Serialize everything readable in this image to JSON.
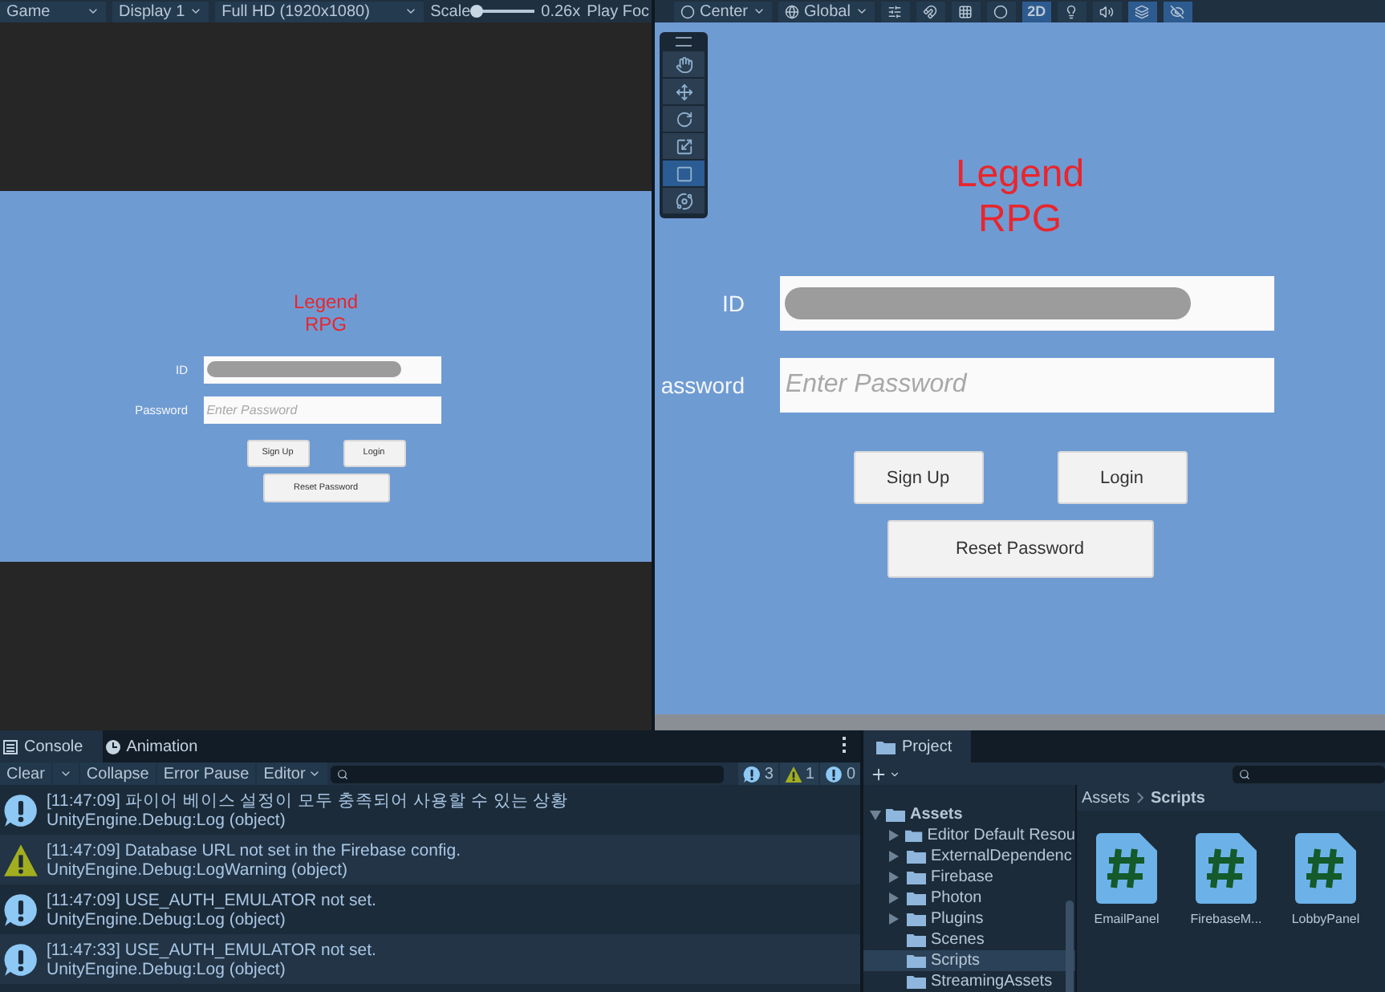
{
  "game_view": {
    "view_menu": "Game",
    "display": "Display 1",
    "resolution": "Full HD (1920x1080)",
    "scale_label": "Scale",
    "scale": {
      "level": 0.0
    },
    "scale_value": "0.26x",
    "play_focused": "Play Foc",
    "screen": {
      "title_lines": [
        "Legend",
        "RPG"
      ],
      "id_label": "ID",
      "id_redacted": true,
      "password_label": "Password",
      "password_placeholder": "Enter Password",
      "buttons": [
        "Sign Up",
        "Login"
      ],
      "reset_button": "Reset Password"
    }
  },
  "scene_view": {
    "pivot": "Center",
    "space": "Global",
    "mode_2d": {
      "label": "2D",
      "on": true
    },
    "tools": [
      {
        "kind": "hand",
        "selected": false
      },
      {
        "kind": "move",
        "selected": false
      },
      {
        "kind": "rotate",
        "selected": false
      },
      {
        "kind": "scale",
        "selected": false
      },
      {
        "kind": "rect",
        "selected": true
      },
      {
        "kind": "transform",
        "selected": false
      }
    ],
    "screen": {
      "title_lines": [
        "Legend",
        "RPG"
      ],
      "id_label": "ID",
      "id_redacted": true,
      "password_label": "assword",
      "password_placeholder": "Enter Password",
      "buttons": [
        "Sign Up",
        "Login"
      ],
      "reset_button": "Reset Password"
    }
  },
  "console": {
    "tabs": [
      {
        "label": "Console",
        "kind": "console",
        "selected": true
      },
      {
        "label": "Animation",
        "kind": "animation",
        "selected": false
      }
    ],
    "toolbar": {
      "clear": "Clear",
      "collapse": "Collapse",
      "error_pause": "Error Pause",
      "editor": "Editor"
    },
    "counts": [
      {
        "kind": "info",
        "count": "3"
      },
      {
        "kind": "warning",
        "count": "1"
      },
      {
        "kind": "error",
        "count": "0"
      }
    ],
    "entries": [
      {
        "kind": "info",
        "message": "[11:47:09] 파이어 베이스 설정이 모두 충족되어 사용할 수 있는 상황",
        "trace": "UnityEngine.Debug:Log (object)"
      },
      {
        "kind": "warning",
        "message": "[11:47:09] Database URL not set in the Firebase config.",
        "trace": "UnityEngine.Debug:LogWarning (object)"
      },
      {
        "kind": "info",
        "message": "[11:47:09] USE_AUTH_EMULATOR not set.",
        "trace": "UnityEngine.Debug:Log (object)"
      },
      {
        "kind": "info",
        "message": "[11:47:33] USE_AUTH_EMULATOR not set.",
        "trace": "UnityEngine.Debug:Log (object)"
      }
    ]
  },
  "project": {
    "tab": "Project",
    "tree": {
      "label": "Assets",
      "expanded": true,
      "children": [
        {
          "label": "Editor Default Resou",
          "has_children": true,
          "selected": false
        },
        {
          "label": "ExternalDependenc",
          "has_children": true,
          "selected": false
        },
        {
          "label": "Firebase",
          "has_children": true,
          "selected": false
        },
        {
          "label": "Photon",
          "has_children": true,
          "selected": false
        },
        {
          "label": "Plugins",
          "has_children": true,
          "selected": false
        },
        {
          "label": "Scenes",
          "has_children": false,
          "selected": false
        },
        {
          "label": "Scripts",
          "has_children": false,
          "selected": true
        },
        {
          "label": "StreamingAssets",
          "has_children": false,
          "selected": false
        }
      ]
    },
    "breadcrumb": [
      "Assets",
      "Scripts"
    ],
    "files": [
      "EmailPanel",
      "FirebaseM...",
      "LobbyPanel"
    ]
  }
}
